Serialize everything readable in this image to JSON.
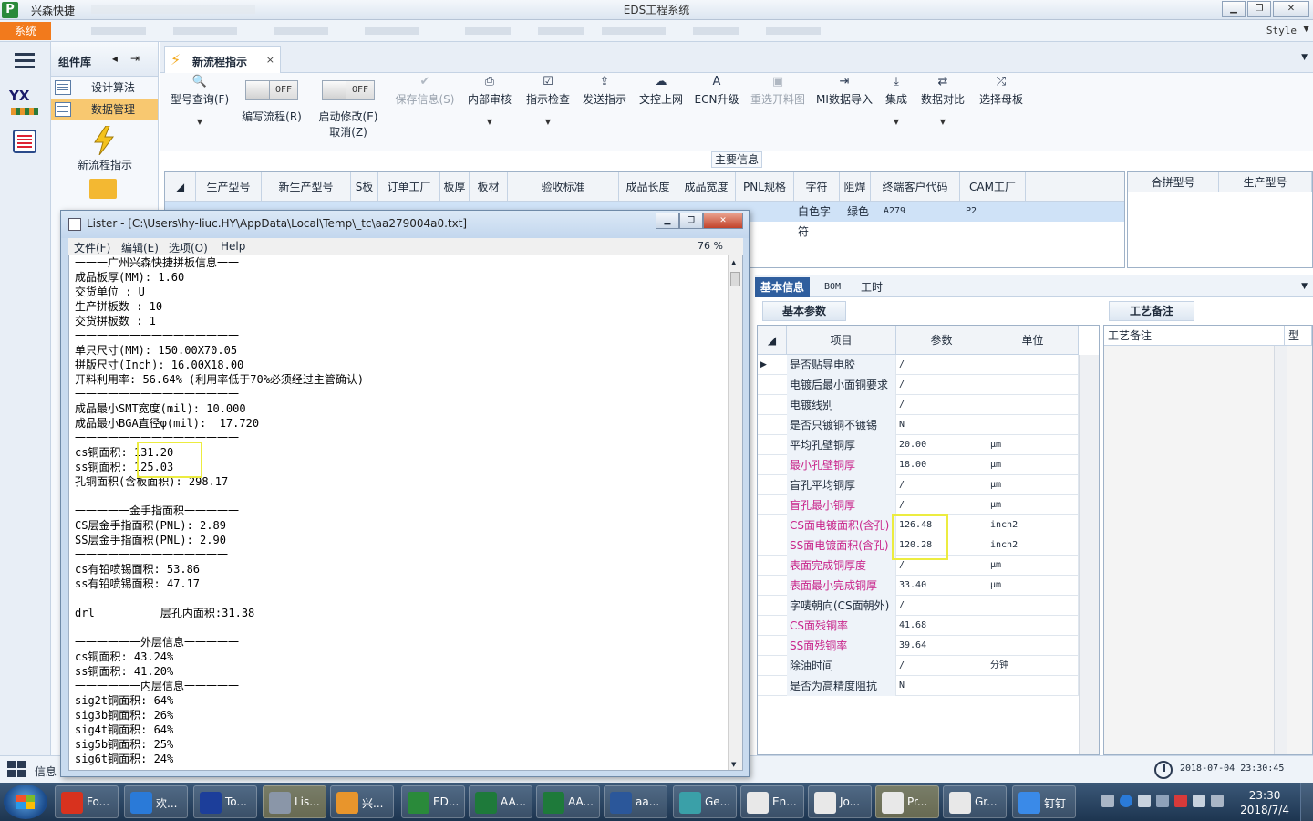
{
  "app": {
    "name": "兴森快捷",
    "window_title": "EDS工程系统",
    "logo_letter": "P"
  },
  "window_controls": {
    "minimize": "▁",
    "maximize": "❐",
    "close": "✕"
  },
  "menustrip": {
    "system": "系统",
    "style": "Style",
    "dropdown_icon": "chevron-down-icon"
  },
  "rail": {
    "yx_logo": "YX"
  },
  "component_panel": {
    "title": "组件库",
    "items": [
      {
        "label": "设计算法",
        "active": false
      },
      {
        "label": "数据管理",
        "active": true
      }
    ],
    "new_flow_label": "新流程指示"
  },
  "doc_tab": {
    "label": "新流程指示",
    "close": "×"
  },
  "toolbar": {
    "buttons": [
      {
        "label": "型号查询(F)",
        "icon": "search-icon",
        "glyph": "🔍",
        "disabled": false,
        "dropdown": true
      },
      {
        "label": "保存信息(S)",
        "icon": "check-icon",
        "glyph": "✔",
        "disabled": true,
        "dropdown": false
      },
      {
        "label": "内部审核",
        "icon": "printer-icon",
        "glyph": "⎙",
        "disabled": false,
        "dropdown": true
      },
      {
        "label": "指示检查",
        "icon": "checkbox-icon",
        "glyph": "☑",
        "disabled": false,
        "dropdown": true
      },
      {
        "label": "发送指示",
        "icon": "upload-icon",
        "glyph": "⇪",
        "disabled": false,
        "dropdown": false
      },
      {
        "label": "文控上网",
        "icon": "cloud-upload-icon",
        "glyph": "☁",
        "disabled": false,
        "dropdown": false
      },
      {
        "label": "ECN升级",
        "icon": "ecn-icon",
        "glyph": "A",
        "disabled": false,
        "dropdown": false
      },
      {
        "label": "重选开料图",
        "icon": "image-icon",
        "glyph": "▣",
        "disabled": true,
        "dropdown": false
      },
      {
        "label": "MI数据导入",
        "icon": "import-icon",
        "glyph": "⇥",
        "disabled": false,
        "dropdown": false
      },
      {
        "label": "集成",
        "icon": "download-icon",
        "glyph": "⤓",
        "disabled": false,
        "dropdown": true
      },
      {
        "label": "数据对比",
        "icon": "compare-icon",
        "glyph": "⇄",
        "disabled": false,
        "dropdown": true
      },
      {
        "label": "选择母板",
        "icon": "shuffle-icon",
        "glyph": "⤮",
        "disabled": false,
        "dropdown": false
      }
    ],
    "toggles": [
      {
        "label": "编写流程(R)",
        "state": "OFF"
      },
      {
        "label": "启动修改(E)",
        "label2": "取消(Z)",
        "state": "OFF"
      }
    ]
  },
  "main_info": {
    "title": "主要信息",
    "columns": [
      "生产型号",
      "新生产型号",
      "S板",
      "订单工厂",
      "板厚",
      "板材",
      "验收标准",
      "成品长度",
      "成品宽度",
      "PNL规格",
      "字符",
      "阻焊",
      "终端客户代码",
      "CAM工厂"
    ],
    "row": {
      "character": "白色字符",
      "solder_mask": "绿色",
      "customer_code": "A279",
      "cam_factory": "P2"
    },
    "side_columns": [
      "合拼型号",
      "生产型号"
    ]
  },
  "lower_tabs": {
    "tabs": [
      "基本信息",
      "BOM",
      "工时"
    ],
    "active": 0
  },
  "basic_params": {
    "tab": "基本参数",
    "headers": [
      "项目",
      "参数",
      "单位"
    ],
    "rows": [
      {
        "item": "是否贴导电胶",
        "value": "/",
        "unit": "",
        "red": false
      },
      {
        "item": "电镀后最小面铜要求",
        "value": "/",
        "unit": "",
        "red": false
      },
      {
        "item": "电镀线别",
        "value": "/",
        "unit": "",
        "red": false
      },
      {
        "item": "是否只镀铜不镀锡",
        "value": "N",
        "unit": "",
        "red": false
      },
      {
        "item": "平均孔壁铜厚",
        "value": "20.00",
        "unit": "μm",
        "red": false
      },
      {
        "item": "最小孔壁铜厚",
        "value": "18.00",
        "unit": "μm",
        "red": true
      },
      {
        "item": "盲孔平均铜厚",
        "value": "/",
        "unit": "μm",
        "red": false
      },
      {
        "item": "盲孔最小铜厚",
        "value": "/",
        "unit": "μm",
        "red": true
      },
      {
        "item": "CS面电镀面积(含孔)",
        "value": "126.48",
        "unit": "inch2",
        "red": true
      },
      {
        "item": "SS面电镀面积(含孔)",
        "value": "120.28",
        "unit": "inch2",
        "red": true
      },
      {
        "item": "表面完成铜厚度",
        "value": "/",
        "unit": "μm",
        "red": true
      },
      {
        "item": "表面最小完成铜厚",
        "value": "33.40",
        "unit": "μm",
        "red": true
      },
      {
        "item": "字唛朝向(CS面朝外)",
        "value": "/",
        "unit": "",
        "red": false
      },
      {
        "item": "CS面残铜率",
        "value": "41.68",
        "unit": "",
        "red": true
      },
      {
        "item": "SS面残铜率",
        "value": "39.64",
        "unit": "",
        "red": true
      },
      {
        "item": "除油时间",
        "value": "/",
        "unit": "分钟",
        "red": false
      },
      {
        "item": "是否为高精度阻抗",
        "value": "N",
        "unit": "",
        "red": false
      }
    ]
  },
  "process_notes": {
    "tab": "工艺备注",
    "header": "工艺备注",
    "header2": "型"
  },
  "statusbar": {
    "info": "信息",
    "datetime": "2018-07-04 23:30:45"
  },
  "lister": {
    "title": "Lister - [C:\\Users\\hy-liuc.HY\\AppData\\Local\\Temp\\_tc\\aa279004a0.txt]",
    "menu": [
      "文件(F)",
      "编辑(E)",
      "选项(O)",
      "Help"
    ],
    "percent": "76 %",
    "lines": [
      "一一一广州兴森快捷拼板信息一一",
      "成品板厚(MM): 1.60",
      "交货单位 : U",
      "生产拼板数 : 10",
      "交货拼板数 : 1",
      "一一一一一一一一一一一一一一一",
      "单只尺寸(MM): 150.00X70.05",
      "拼版尺寸(Inch): 16.00X18.00",
      "开料利用率: 56.64% (利用率低于70%必须经过主管确认)",
      "一一一一一一一一一一一一一一一",
      "成品最小SMT宽度(mil): 10.000",
      "成品最小BGA直径φ(mil):  17.720",
      "一一一一一一一一一一一一一一一",
      "cs铜面积: 131.20",
      "ss铜面积: 125.03",
      "孔铜面积(含板面积): 298.17",
      "",
      "一一一一一金手指面积一一一一一",
      "CS层金手指面积(PNL): 2.89",
      "SS层金手指面积(PNL): 2.90",
      "一一一一一一一一一一一一一一",
      "cs有铅喷锡面积: 53.86",
      "ss有铅喷锡面积: 47.17",
      "一一一一一一一一一一一一一一",
      "drl          层孔内面积:31.38",
      "",
      "一一一一一一外层信息一一一一一",
      "cs铜面积: 43.24%",
      "ss铜面积: 41.20%",
      "一一一一一一内层信息一一一一一",
      "sig2t铜面积: 64%",
      "sig3b铜面积: 26%",
      "sig4t铜面积: 64%",
      "sig5b铜面积: 25%",
      "sig6t铜面积: 24%"
    ]
  },
  "taskbar": {
    "tasks": [
      {
        "label": "Fo...",
        "color": "#d8321e"
      },
      {
        "label": "欢...",
        "color": "#2a7ad8"
      },
      {
        "label": "To...",
        "color": "#1c3e9a"
      },
      {
        "label": "Lis...",
        "color": "#8a96a8"
      },
      {
        "label": "兴...",
        "color": "#e8952c"
      },
      {
        "label": "ED...",
        "color": "#2a8a3a"
      },
      {
        "label": "AA...",
        "color": "#1e7a3a"
      },
      {
        "label": "AA...",
        "color": "#1e7a3a"
      },
      {
        "label": "aa...",
        "color": "#2b579a"
      },
      {
        "label": "Ge...",
        "color": "#3aa0a8"
      },
      {
        "label": "En...",
        "color": "#e8e8e8"
      },
      {
        "label": "Jo...",
        "color": "#e8e8e8"
      },
      {
        "label": "Pr...",
        "color": "#e8e8e8"
      },
      {
        "label": "Gr...",
        "color": "#e8e8e8"
      },
      {
        "label": "钉钉",
        "color": "#3a8ae8"
      }
    ],
    "time": "23:30",
    "date": "2018/7/4"
  }
}
